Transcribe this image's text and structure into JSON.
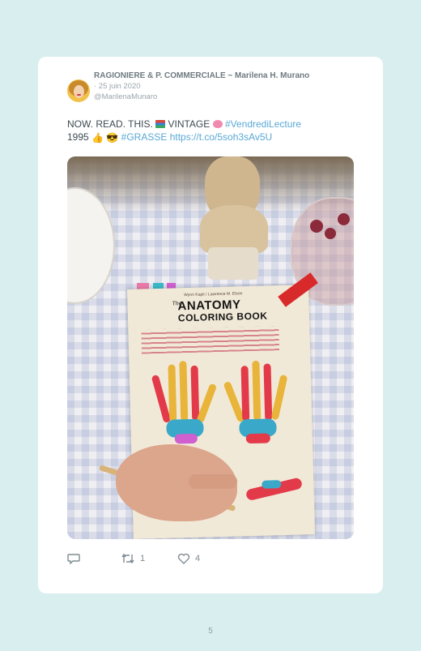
{
  "tweet": {
    "author_name": "RAGIONIERE & P. COMMERCIALE ~ Marilena H. Murano",
    "date": "· 25 juin 2020",
    "handle": "@MarilenaMunaro",
    "text_part1": "NOW. READ. THIS.",
    "text_part2": "VINTAGE",
    "hashtag1": "#VendrediLecture",
    "text_part3": "1995",
    "hashtag2": "#GRASSE",
    "link": "https://t.co/5soh3sAv5U",
    "emoji_thumbs": "👍",
    "emoji_cool": "😎"
  },
  "photo": {
    "book_authors": "Wynn Kapit / Lawrence M. Elson",
    "book_title_the": "The",
    "book_title_line1": "ANATOMY",
    "book_title_line2": "COLORING BOOK"
  },
  "actions": {
    "reply_count": "",
    "retweet_count": "1",
    "like_count": "4"
  },
  "page_number": "5",
  "colors": {
    "background": "#d9eeee",
    "card": "#ffffff",
    "link": "#59a8d6",
    "text": "#3d4a52"
  }
}
